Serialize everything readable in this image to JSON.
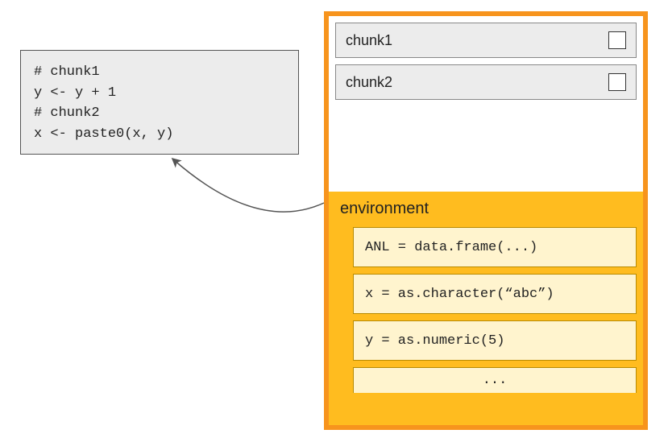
{
  "code_box": {
    "line1": "# chunk1",
    "line2": "y <- y + 1",
    "line3": "# chunk2",
    "line4": "x <- paste0(x, y)"
  },
  "panel": {
    "chunks": [
      {
        "label": "chunk1"
      },
      {
        "label": "chunk2"
      }
    ],
    "environment": {
      "title": "environment",
      "items": [
        "ANL = data.frame(...)",
        "x = as.character(“abc”)",
        "y = as.numeric(5)",
        "..."
      ]
    }
  },
  "colors": {
    "panel_border": "#f7941d",
    "env_bg": "#ffbc1f",
    "env_item_bg": "#fff4ce"
  }
}
